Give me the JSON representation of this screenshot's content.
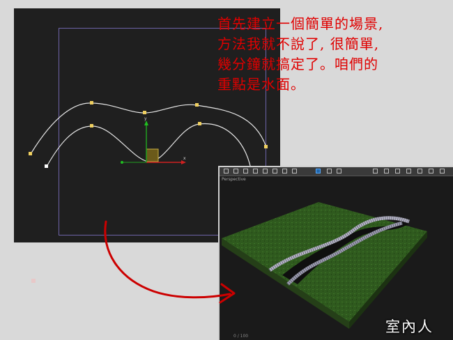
{
  "annotation": {
    "lines": [
      "首先建立一個簡單的場景,",
      "方法我就不說了, 很簡單,",
      "幾分鐘就搞定了。咱們的",
      "重點是水面。"
    ]
  },
  "top_viewport": {
    "axis_x_label": "x",
    "axis_y_label": "y"
  },
  "perspective_viewport": {
    "label": "Perspective",
    "status": "0 / 100"
  },
  "colors": {
    "annotation": "#e00000",
    "arrow": "#cc0000",
    "spline": "#e6e6e6",
    "vertex": "#f0d060",
    "grass": "#2f5a1e",
    "frame": "#6d63a8"
  },
  "icons": [
    "select-icon",
    "move-icon",
    "rotate-icon",
    "scale-icon",
    "snap-icon",
    "zoom-icon",
    "pan-icon",
    "orbit-icon"
  ],
  "watermark": "室內人"
}
